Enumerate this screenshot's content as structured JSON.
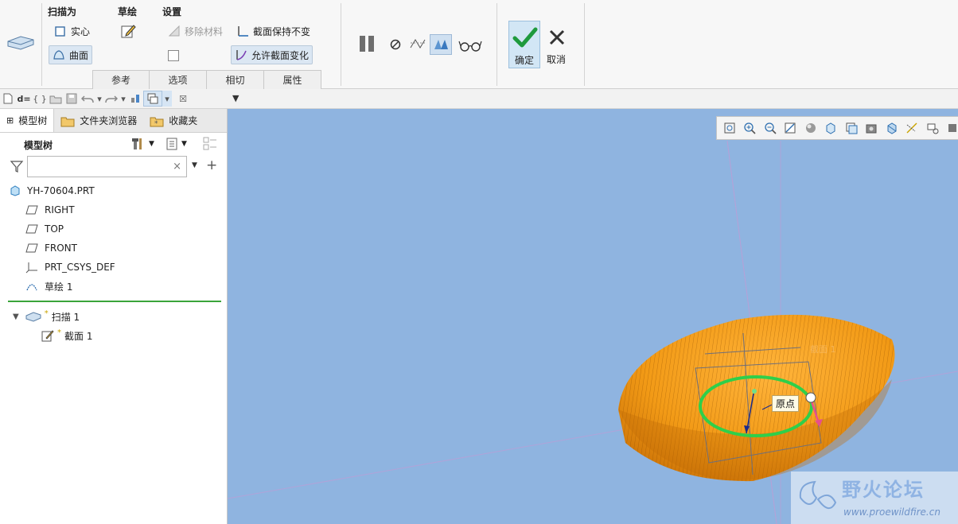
{
  "ribbon": {
    "groups": {
      "sweep_as": "扫描为",
      "sketch": "草绘",
      "settings": "设置"
    },
    "solid": "实心",
    "surface": "曲面",
    "remove_material": "移除材料",
    "section_constant": "截面保持不变",
    "allow_section_change": "允许截面变化",
    "ok": "确定",
    "cancel": "取消",
    "tabs": [
      "参考",
      "选项",
      "相切",
      "属性"
    ]
  },
  "panel": {
    "tabs": [
      "模型树",
      "文件夹浏览器",
      "收藏夹"
    ],
    "tree_title": "模型树",
    "search_placeholder": "",
    "tree": {
      "root": "YH-70604.PRT",
      "items": [
        "RIGHT",
        "TOP",
        "FRONT",
        "PRT_CSYS_DEF",
        "草绘 1"
      ],
      "sweep": "扫描 1",
      "section": "截面 1",
      "new_marker": "*"
    }
  },
  "viewport": {
    "origin_label": "原点",
    "faint_label": "截面 1"
  },
  "watermark": {
    "title": "野火论坛",
    "url": "www.proewildfire.cn"
  },
  "colors": {
    "viewport_bg": "#8fb4e0",
    "model": "#f29a16",
    "accent": "#2e8bd8",
    "ok_check": "#1f9a3d"
  }
}
